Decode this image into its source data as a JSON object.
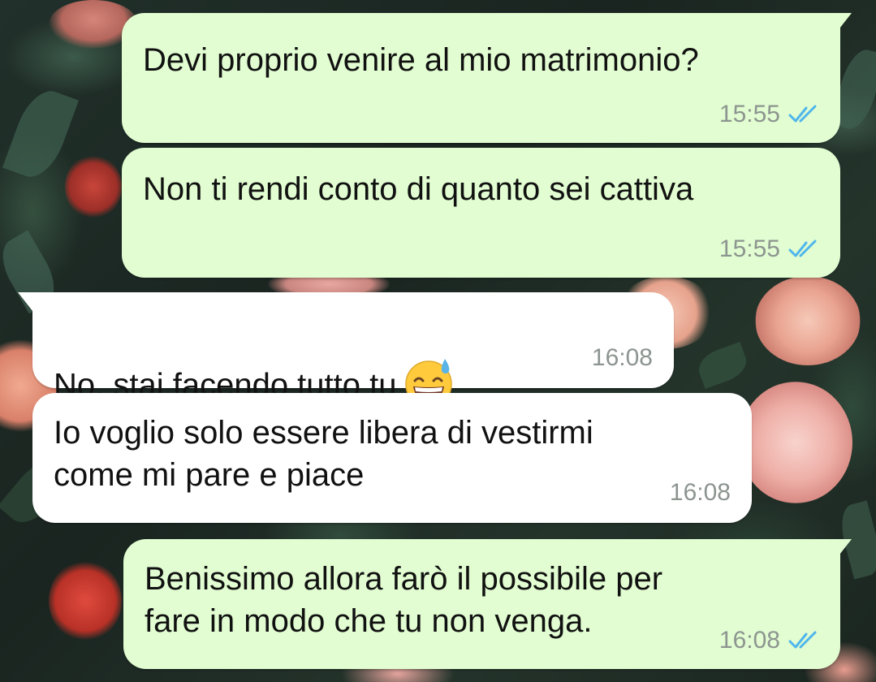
{
  "conversation": {
    "messages": [
      {
        "direction": "outgoing",
        "text": "Devi proprio venire al mio matrimonio?",
        "time": "15:55",
        "status_icon": "double-check-read-icon",
        "status_color": "#4fb6ec"
      },
      {
        "direction": "outgoing",
        "text": "Non ti rendi conto di quanto sei cattiva",
        "time": "15:55",
        "status_icon": "double-check-read-icon",
        "status_color": "#4fb6ec"
      },
      {
        "direction": "incoming",
        "text": "No, stai facendo tutto tu",
        "emoji": "grinning-face-with-sweat-icon",
        "time": "16:08"
      },
      {
        "direction": "incoming",
        "text": "Io voglio solo essere libera di vestirmi\ncome mi pare e piace",
        "time": "16:08"
      },
      {
        "direction": "outgoing",
        "text": "Benissimo allora farò il possibile per\nfare in modo che tu non venga.",
        "time": "16:08",
        "status_icon": "double-check-read-icon",
        "status_color": "#4fb6ec"
      }
    ]
  },
  "theme": {
    "outgoing_bubble": "#e1fdd1",
    "incoming_bubble": "#ffffff",
    "timestamp": "#8d9590",
    "read_ticks": "#4fb6ec"
  }
}
